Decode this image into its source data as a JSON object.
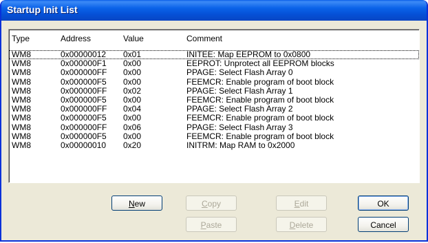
{
  "window": {
    "title": "Startup Init List"
  },
  "columns": {
    "type": "Type",
    "address": "Address",
    "value": "Value",
    "comment": "Comment"
  },
  "rows": [
    {
      "type": "WM8",
      "address": "0x00000012",
      "value": "0x01",
      "comment": "INITEE: Map EEPROM to 0x0800"
    },
    {
      "type": "WM8",
      "address": "0x000000F1",
      "value": "0x00",
      "comment": "EEPROT: Unprotect all EEPROM blocks"
    },
    {
      "type": "WM8",
      "address": "0x000000FF",
      "value": "0x00",
      "comment": "PPAGE: Select Flash Array 0"
    },
    {
      "type": "WM8",
      "address": "0x000000F5",
      "value": "0x00",
      "comment": "FEEMCR: Enable program of boot block"
    },
    {
      "type": "WM8",
      "address": "0x000000FF",
      "value": "0x02",
      "comment": "PPAGE: Select Flash Array 1"
    },
    {
      "type": "WM8",
      "address": "0x000000F5",
      "value": "0x00",
      "comment": "FEEMCR: Enable program of boot block"
    },
    {
      "type": "WM8",
      "address": "0x000000FF",
      "value": "0x04",
      "comment": "PPAGE: Select Flash Array 2"
    },
    {
      "type": "WM8",
      "address": "0x000000F5",
      "value": "0x00",
      "comment": "FEEMCR: Enable program of boot block"
    },
    {
      "type": "WM8",
      "address": "0x000000FF",
      "value": "0x06",
      "comment": "PPAGE: Select Flash Array 3"
    },
    {
      "type": "WM8",
      "address": "0x000000F5",
      "value": "0x00",
      "comment": "FEEMCR: Enable program of boot block"
    },
    {
      "type": "WM8",
      "address": "0x00000010",
      "value": "0x20",
      "comment": "INITRM: Map RAM to 0x2000"
    }
  ],
  "buttons": {
    "new": {
      "first": "N",
      "rest": "ew"
    },
    "copy": {
      "first": "C",
      "rest": "opy"
    },
    "paste": {
      "first": "P",
      "rest": "aste"
    },
    "edit": {
      "first": "E",
      "rest": "dit"
    },
    "delete": {
      "first": "D",
      "rest": "elete"
    },
    "ok": "OK",
    "cancel": "Cancel"
  }
}
